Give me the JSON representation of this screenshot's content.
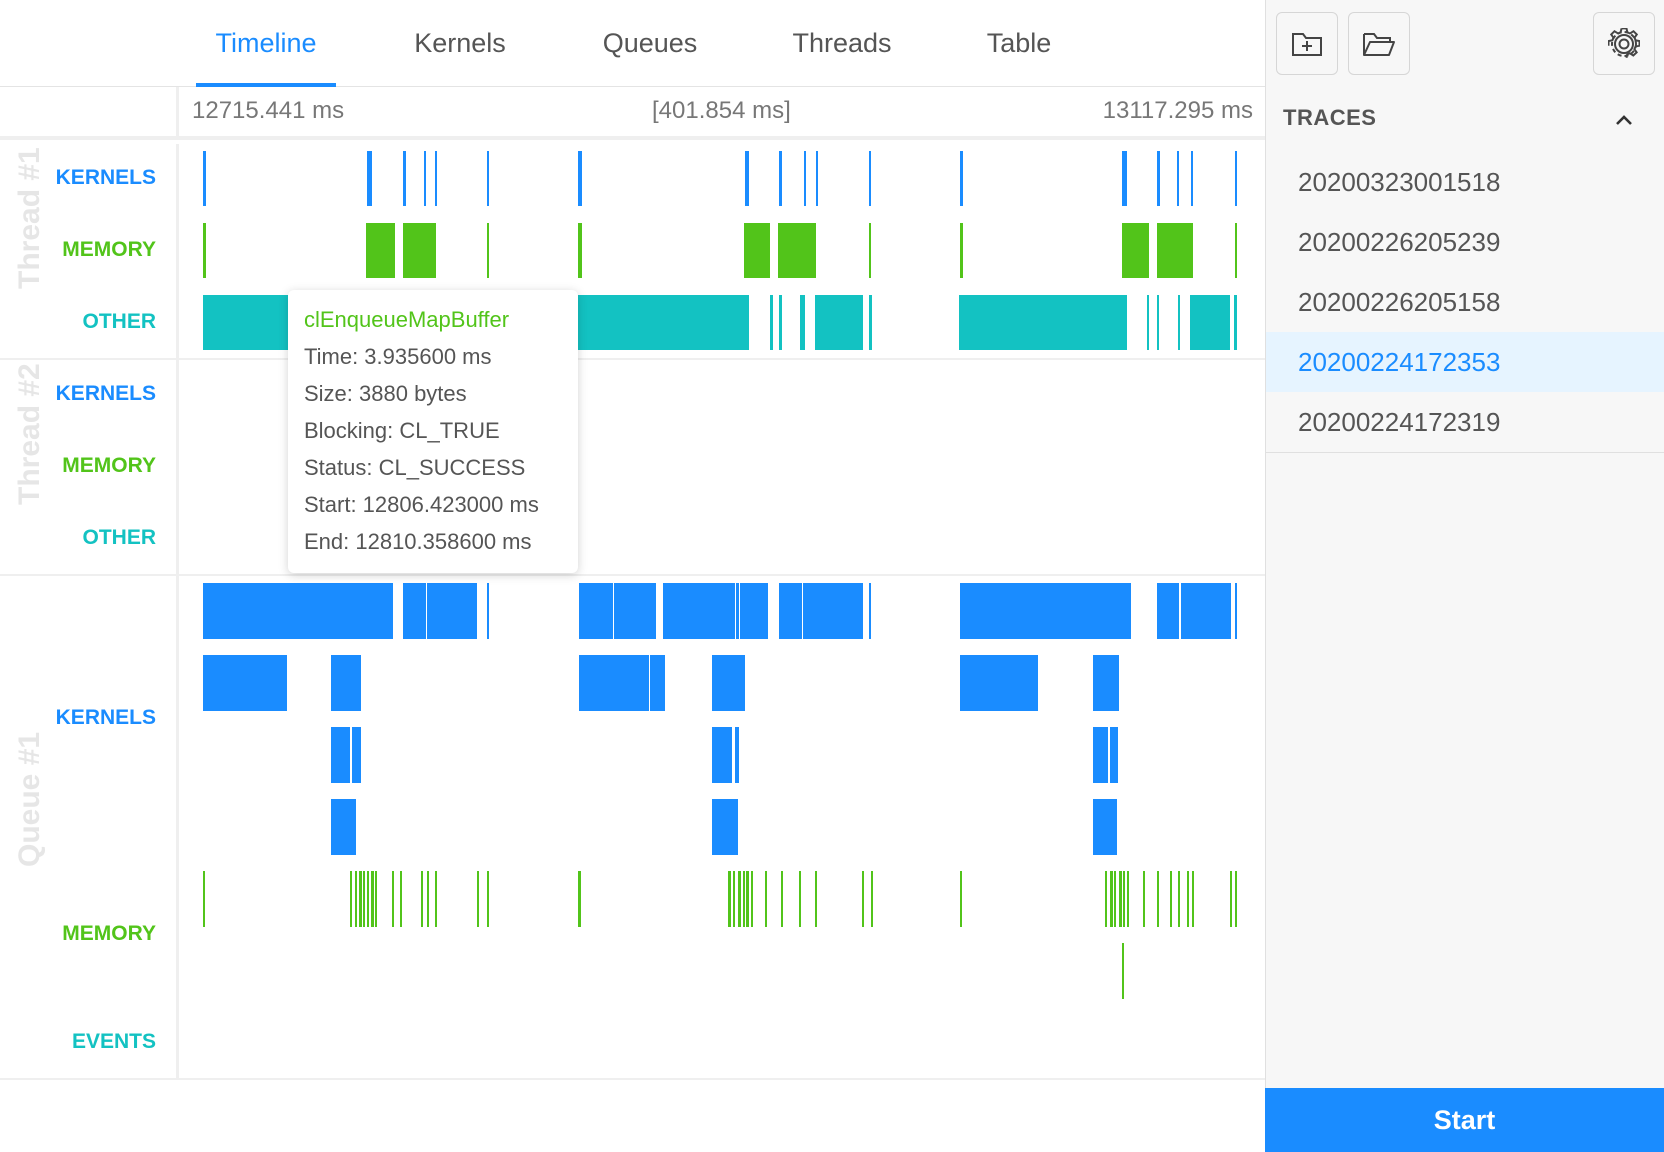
{
  "tabs": [
    {
      "label": "Timeline",
      "active": true
    },
    {
      "label": "Kernels",
      "active": false
    },
    {
      "label": "Queues",
      "active": false
    },
    {
      "label": "Threads",
      "active": false
    },
    {
      "label": "Table",
      "active": false
    }
  ],
  "ruler": {
    "start": "12715.441 ms",
    "span": "[401.854 ms]",
    "end": "13117.295 ms"
  },
  "groups": [
    {
      "title": "Thread #1",
      "lanes": [
        "KERNELS",
        "MEMORY",
        "OTHER"
      ]
    },
    {
      "title": "Thread #2",
      "lanes": [
        "KERNELS",
        "MEMORY",
        "OTHER"
      ]
    },
    {
      "title": "Queue #1",
      "lanes": [
        "KERNELS",
        "MEMORY",
        "EVENTS"
      ]
    }
  ],
  "colors": {
    "kernels": "#1a8cff",
    "memory": "#52c41a",
    "other": "#13c2c2",
    "accent": "#1a8cff"
  },
  "tooltip": {
    "title": "clEnqueueMapBuffer",
    "time": "Time: 3.935600 ms",
    "size": "Size: 3880 bytes",
    "blocking": "Blocking: CL_TRUE",
    "status": "Status: CL_SUCCESS",
    "start": "Start: 12806.423000 ms",
    "end": "End: 12810.358600 ms"
  },
  "sidebar": {
    "toolbar": {
      "new_icon": "folder-plus-icon",
      "open_icon": "folder-open-icon",
      "settings_icon": "gear-icon"
    },
    "traces_title": "TRACES",
    "traces": [
      {
        "label": "20200323001518",
        "selected": false
      },
      {
        "label": "20200226205239",
        "selected": false
      },
      {
        "label": "20200226205158",
        "selected": false
      },
      {
        "label": "20200224172353",
        "selected": true
      },
      {
        "label": "20200224172319",
        "selected": false
      }
    ],
    "start_label": "Start"
  }
}
